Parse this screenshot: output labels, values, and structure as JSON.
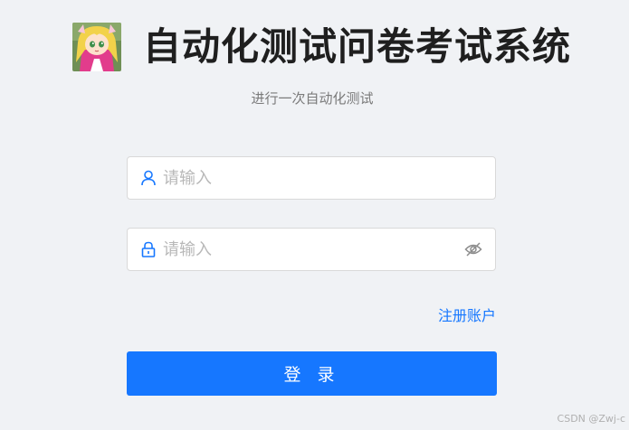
{
  "header": {
    "title": "自动化测试问卷考试系统",
    "subtitle": "进行一次自动化测试",
    "logo_icon": "anime-avatar-logo"
  },
  "form": {
    "username": {
      "placeholder": "请输入",
      "value": "",
      "icon": "user-icon"
    },
    "password": {
      "placeholder": "请输入",
      "value": "",
      "icon": "lock-icon",
      "toggle_icon": "eye-off-icon"
    },
    "register_link": "注册账户",
    "login_button": "登 录"
  },
  "watermark": "CSDN @Zwj-c",
  "colors": {
    "background": "#f0f2f5",
    "primary": "#1677ff",
    "title": "#1f1f1f",
    "subtitle": "#7a7a7a",
    "placeholder": "#b8b8b8",
    "border": "#d9d9d9"
  }
}
